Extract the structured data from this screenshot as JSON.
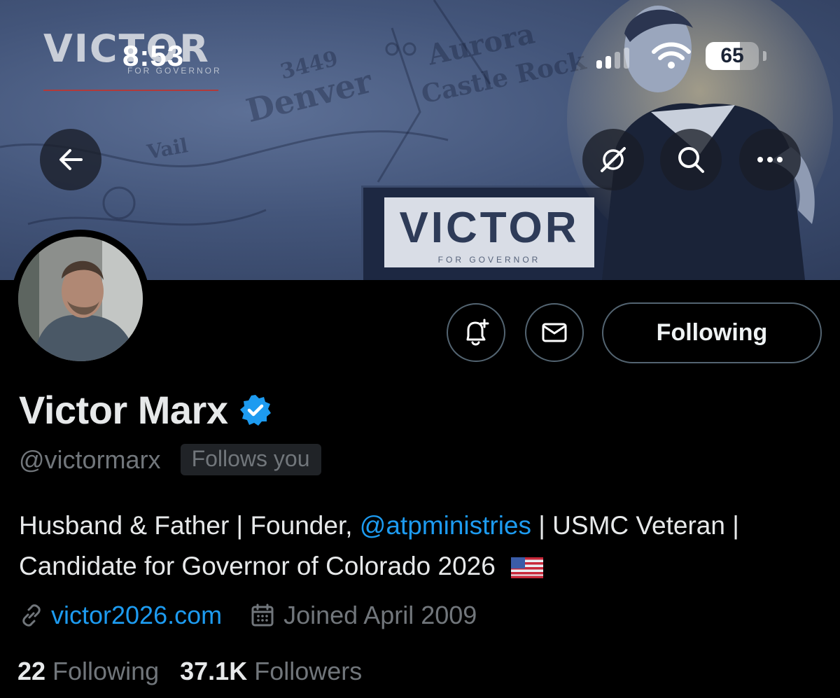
{
  "status_bar": {
    "time": "8:53",
    "battery_percent": "65",
    "battery_level": 0.65
  },
  "banner": {
    "logo_text": "VICTOR",
    "logo_sub": "FOR GOVERNOR",
    "podium_text": "VICTOR",
    "podium_sub": "FOR GOVERNOR",
    "map_words": [
      "Denver",
      "Aurora",
      "Castle Rock",
      "3449",
      "Vail"
    ]
  },
  "icons": {
    "back": "back-arrow-icon",
    "grok": "grok-icon",
    "search": "search-icon",
    "more": "more-icon",
    "notify": "bell-plus-icon",
    "message": "envelope-icon",
    "verified": "verified-badge-icon",
    "link": "link-icon",
    "calendar": "calendar-icon",
    "flag": "us-flag-icon"
  },
  "profile": {
    "display_name": "Victor Marx",
    "handle": "@victormarx",
    "follows_you": "Follows you",
    "follow_button": "Following",
    "bio_part1": "Husband & Father | Founder, ",
    "bio_mention": "@atpministries",
    "bio_part2": " | USMC Veteran | Candidate for Governor of Colorado 2026",
    "website": "victor2026.com",
    "joined": "Joined April 2009",
    "following_count": "22",
    "following_label": "Following",
    "followers_count": "37.1K",
    "followers_label": "Followers"
  },
  "colors": {
    "background": "#000000",
    "accent_blue": "#1d9bf0",
    "muted_text": "#71767b",
    "border": "#536471",
    "banner_tint": "#43557a"
  }
}
